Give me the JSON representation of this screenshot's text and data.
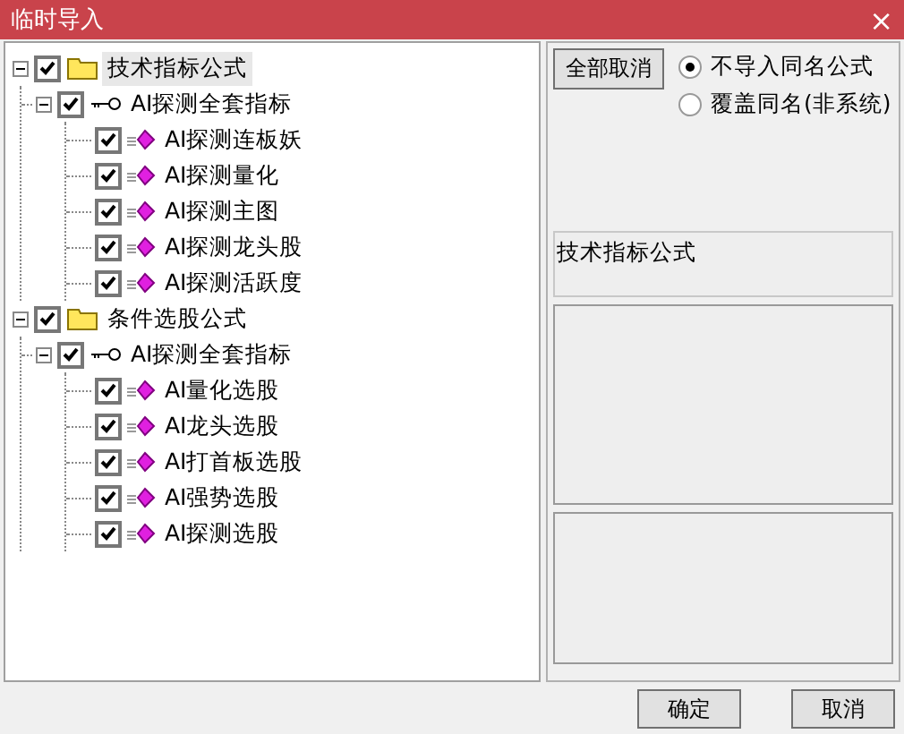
{
  "window": {
    "title": "临时导入",
    "close": "×"
  },
  "tree": [
    {
      "kind": "folder",
      "label": "技术指标公式",
      "checked": true,
      "expanded": true,
      "selected": true,
      "children": [
        {
          "kind": "key",
          "label": "AI探测全套指标",
          "checked": true,
          "expanded": true,
          "selected": false,
          "children": [
            {
              "kind": "formula",
              "label": "AI探测连板妖",
              "checked": true,
              "selected": false
            },
            {
              "kind": "formula",
              "label": "AI探测量化",
              "checked": true,
              "selected": false
            },
            {
              "kind": "formula",
              "label": "AI探测主图",
              "checked": true,
              "selected": false
            },
            {
              "kind": "formula",
              "label": "AI探测龙头股",
              "checked": true,
              "selected": false
            },
            {
              "kind": "formula",
              "label": "AI探测活跃度",
              "checked": true,
              "selected": false
            }
          ]
        }
      ]
    },
    {
      "kind": "folder",
      "label": "条件选股公式",
      "checked": true,
      "expanded": true,
      "selected": false,
      "children": [
        {
          "kind": "key",
          "label": "AI探测全套指标",
          "checked": true,
          "expanded": true,
          "selected": false,
          "children": [
            {
              "kind": "formula",
              "label": "AI量化选股",
              "checked": true,
              "selected": false
            },
            {
              "kind": "formula",
              "label": "AI龙头选股",
              "checked": true,
              "selected": false
            },
            {
              "kind": "formula",
              "label": "AI打首板选股",
              "checked": true,
              "selected": false
            },
            {
              "kind": "formula",
              "label": "AI强势选股",
              "checked": true,
              "selected": false
            },
            {
              "kind": "formula",
              "label": "AI探测选股",
              "checked": true,
              "selected": false
            }
          ]
        }
      ]
    }
  ],
  "deselect_all_button": "全部取消",
  "options": [
    {
      "label": "不导入同名公式",
      "selected": true
    },
    {
      "label": "覆盖同名(非系统)",
      "selected": false
    }
  ],
  "category_box": "技术指标公式",
  "buttons": [
    "确定",
    "取消"
  ]
}
